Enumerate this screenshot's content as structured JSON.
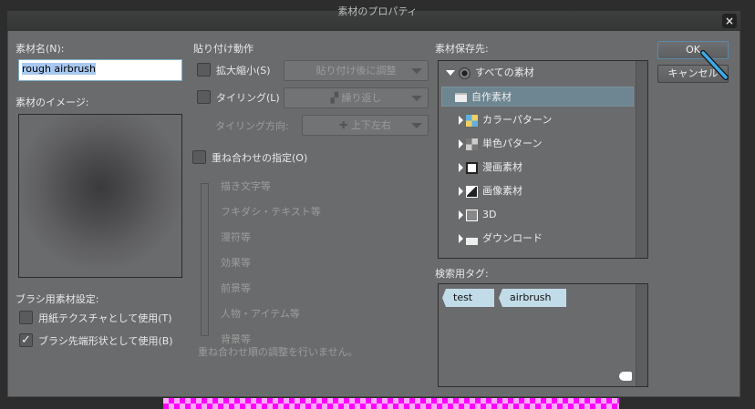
{
  "window": {
    "title": "素材のプロパティ",
    "close_label": "×"
  },
  "left": {
    "name_label": "素材名(N):",
    "name_value": "rough airbrush",
    "image_label": "素材のイメージ:",
    "brush_settings_label": "ブラシ用素材設定:",
    "paper_texture": {
      "label": "用紙テクスチャとして使用(T)",
      "checked": false
    },
    "brush_tip": {
      "label": "ブラシ先端形状として使用(B)",
      "checked": true,
      "mark": "✓"
    }
  },
  "paste": {
    "heading": "貼り付け動作",
    "scale": {
      "label": "拡大縮小(S)",
      "value": "貼り付け後に調整"
    },
    "tiling": {
      "label": "タイリング(L)",
      "value": "繰り返し"
    },
    "tiling_direction": {
      "label": "タイリング方向:",
      "value": "上下左右"
    },
    "overlay": {
      "label": "重ね合わせの指定(O)"
    },
    "layers": [
      "描き文字等",
      "フキダシ・テキスト等",
      "漫符等",
      "効果等",
      "前景等",
      "人物・アイテム等",
      "背景等"
    ],
    "footer": "重ね合わせ順の調整を行いません。"
  },
  "save": {
    "label": "素材保存先:",
    "tree": [
      {
        "label": "すべての素材",
        "icon": "circle-icon"
      },
      {
        "label": "自作素材",
        "icon": "folder-icon",
        "selected": true
      },
      {
        "label": "カラーパターン",
        "icon": "color-pattern-icon"
      },
      {
        "label": "単色パターン",
        "icon": "mono-pattern-icon"
      },
      {
        "label": "漫画素材",
        "icon": "manga-icon"
      },
      {
        "label": "画像素材",
        "icon": "image-icon"
      },
      {
        "label": "3D",
        "icon": "cube-icon"
      },
      {
        "label": "ダウンロード",
        "icon": "download-icon"
      }
    ]
  },
  "tags": {
    "label": "検索用タグ:",
    "items": [
      "test",
      "airbrush"
    ]
  },
  "buttons": {
    "ok": "OK",
    "cancel": "キャンセル"
  }
}
